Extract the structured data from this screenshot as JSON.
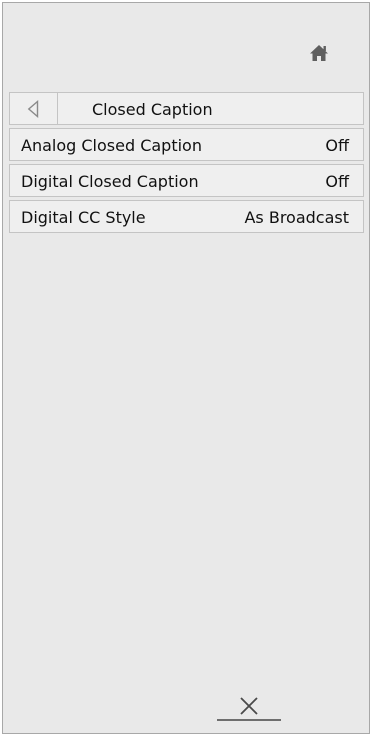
{
  "header": {
    "home_icon": "home-icon"
  },
  "menu": {
    "title": "Closed Caption",
    "back_icon": "back-arrow-icon",
    "items": [
      {
        "label": "Analog Closed Caption",
        "value": "Off"
      },
      {
        "label": "Digital Closed Caption",
        "value": "Off"
      },
      {
        "label": "Digital CC Style",
        "value": "As Broadcast"
      }
    ]
  },
  "footer": {
    "close_icon": "close-icon"
  },
  "colors": {
    "panel_background": "#e9e9e9",
    "row_background": "#efefef",
    "border": "#c4c4c4",
    "icon": "#5f5f5f"
  }
}
